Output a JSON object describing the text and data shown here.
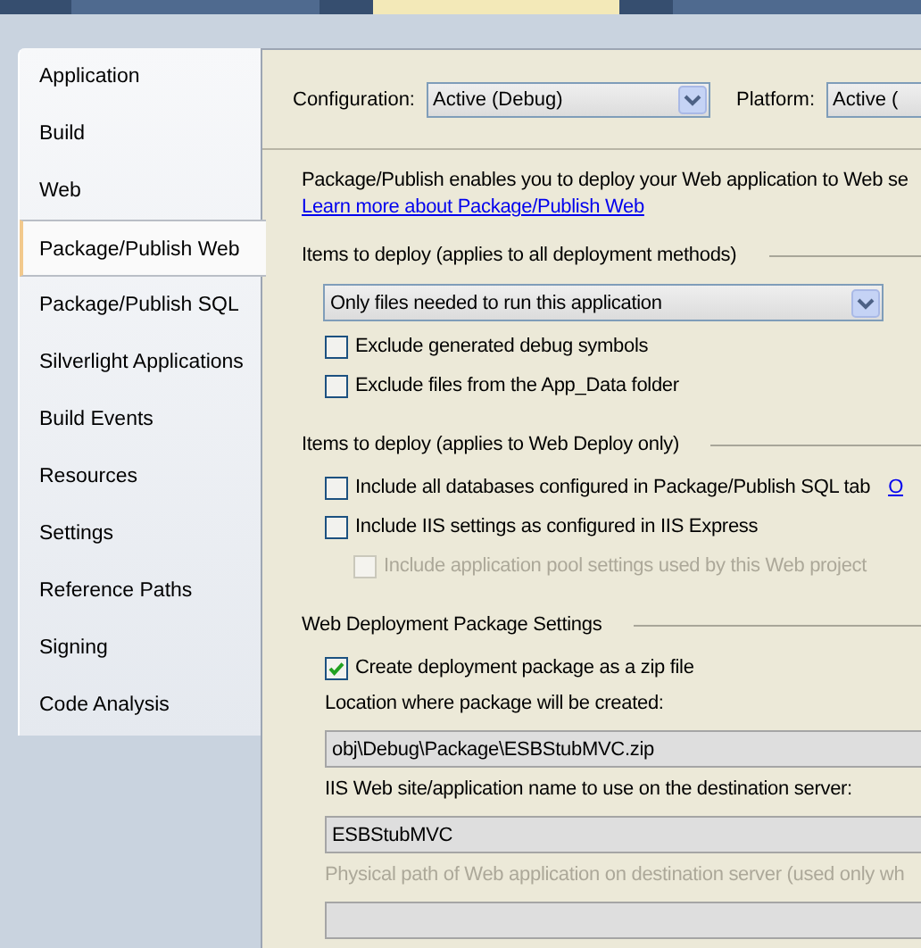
{
  "document_tabs": [
    {
      "selected": false
    },
    {
      "selected": true
    },
    {
      "selected": false
    }
  ],
  "sidebar": {
    "items": [
      {
        "label": "Application",
        "selected": false
      },
      {
        "label": "Build",
        "selected": false
      },
      {
        "label": "Web",
        "selected": false
      },
      {
        "label": "Package/Publish Web",
        "selected": true
      },
      {
        "label": "Package/Publish SQL",
        "selected": false
      },
      {
        "label": "Silverlight Applications",
        "selected": false
      },
      {
        "label": "Build Events",
        "selected": false
      },
      {
        "label": "Resources",
        "selected": false
      },
      {
        "label": "Settings",
        "selected": false
      },
      {
        "label": "Reference Paths",
        "selected": false
      },
      {
        "label": "Signing",
        "selected": false
      },
      {
        "label": "Code Analysis",
        "selected": false
      }
    ]
  },
  "toolbar": {
    "configuration_label": "Configuration:",
    "configuration_value": "Active (Debug)",
    "platform_label": "Platform:",
    "platform_value": "Active ("
  },
  "intro": {
    "text": "Package/Publish enables you to deploy your Web application to Web se",
    "link": "Learn more about Package/Publish Web"
  },
  "sections": [
    {
      "title": "Items to deploy (applies to all deployment methods)",
      "items": [
        {
          "kind": "dropdown",
          "value": "Only files needed to run this application"
        },
        {
          "kind": "checkbox",
          "label": "Exclude generated debug symbols",
          "checked": false,
          "disabled": false
        },
        {
          "kind": "checkbox",
          "label": "Exclude files from the App_Data folder",
          "checked": false,
          "disabled": false
        }
      ]
    },
    {
      "title": "Items to deploy (applies to Web Deploy only)",
      "items": [
        {
          "kind": "checkbox",
          "label": "Include all databases configured in Package/Publish SQL tab",
          "checked": false,
          "disabled": false,
          "link": "O"
        },
        {
          "kind": "checkbox",
          "label": "Include IIS settings as configured in IIS Express",
          "checked": false,
          "disabled": false
        },
        {
          "kind": "subcheckbox",
          "label": "Include application pool settings used by this Web project",
          "checked": false,
          "disabled": true
        }
      ]
    },
    {
      "title": "Web Deployment Package Settings",
      "items": [
        {
          "kind": "checkbox",
          "label": "Create deployment package as a zip file",
          "checked": true,
          "disabled": false
        },
        {
          "kind": "label",
          "label": "Location where package will be created:",
          "disabled": false
        },
        {
          "kind": "textbox",
          "value": "obj\\Debug\\Package\\ESBStubMVC.zip"
        },
        {
          "kind": "label",
          "label": "IIS Web site/application name to use on the destination server:",
          "disabled": false
        },
        {
          "kind": "textbox",
          "value": "ESBStubMVC"
        },
        {
          "kind": "label",
          "label": "Physical path of Web application on destination server (used only wh",
          "disabled": true
        },
        {
          "kind": "textbox",
          "value": ""
        }
      ]
    }
  ]
}
